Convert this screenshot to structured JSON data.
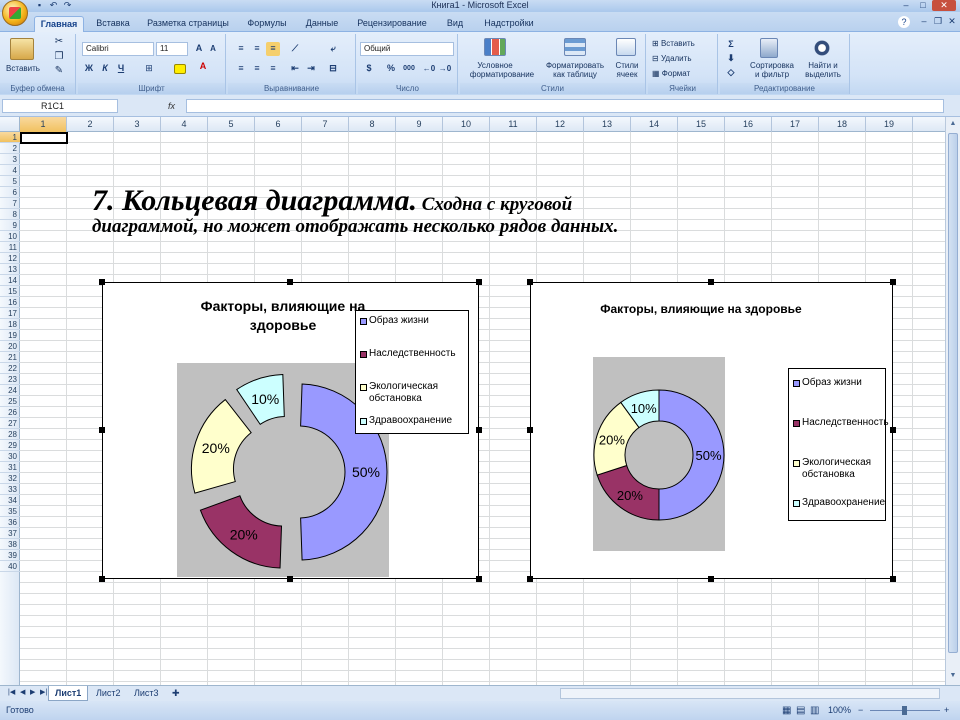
{
  "window": {
    "title": "Книга1 - Microsoft Excel"
  },
  "quick_access": [
    "save-icon",
    "undo-icon",
    "redo-icon"
  ],
  "tabs": [
    "Главная",
    "Вставка",
    "Разметка страницы",
    "Формулы",
    "Данные",
    "Рецензирование",
    "Вид",
    "Надстройки"
  ],
  "ribbon": {
    "clipboard": {
      "label": "Буфер обмена",
      "paste": "Вставить"
    },
    "font": {
      "label": "Шрифт",
      "name": "Calibri",
      "size": "11",
      "bold": "Ж",
      "italic": "К",
      "underline": "Ч"
    },
    "alignment": {
      "label": "Выравнивание"
    },
    "number": {
      "label": "Число",
      "format": "Общий",
      "percent": "%",
      "thousands": "000"
    },
    "styles": {
      "label": "Стили",
      "cond_l1": "Условное",
      "cond_l2": "форматирование",
      "table_l1": "Форматировать",
      "table_l2": "как таблицу",
      "cell_l1": "Стили",
      "cell_l2": "ячеек"
    },
    "cells": {
      "label": "Ячейки",
      "insert": "Вставить",
      "delete": "Удалить",
      "format": "Формат"
    },
    "editing": {
      "label": "Редактирование",
      "sigma": "Σ",
      "sort_l1": "Сортировка",
      "sort_l2": "и фильтр",
      "find_l1": "Найти и",
      "find_l2": "выделить"
    }
  },
  "formula_bar": {
    "name_box": "R1C1",
    "fx": "fx",
    "value": ""
  },
  "columns": [
    "1",
    "2",
    "3",
    "4",
    "5",
    "6",
    "7",
    "8",
    "9",
    "10",
    "11",
    "12",
    "13",
    "14",
    "15",
    "16",
    "17",
    "18",
    "19"
  ],
  "rows": [
    "1",
    "2",
    "3",
    "4",
    "5",
    "6",
    "7",
    "8",
    "9",
    "10",
    "11",
    "12",
    "13",
    "14",
    "15",
    "16",
    "17",
    "18",
    "19",
    "20",
    "21",
    "22",
    "23",
    "24",
    "25",
    "26",
    "27",
    "28",
    "29",
    "30",
    "31",
    "32",
    "33",
    "34",
    "35",
    "36",
    "37",
    "38",
    "39",
    "40"
  ],
  "heading": {
    "big": "7.  Кольцевая диаграмма.",
    "small1": " Сходна с круговой",
    "small2": "диаграммой, но может отображать несколько рядов данных."
  },
  "chart_data": [
    {
      "type": "donut",
      "title_line1": "Факторы, влияющие на",
      "title_line2": "здоровье",
      "exploded": true,
      "categories": [
        "Образ жизни",
        "Наследственность",
        "Экологическая обстановка",
        "Здравоохранение"
      ],
      "legend_lines": [
        [
          "Образ жизни"
        ],
        [
          "Наследственность"
        ],
        [
          "Экологическая",
          "обстановка"
        ],
        [
          "Здравоохранение"
        ]
      ],
      "values": [
        50,
        20,
        20,
        10
      ],
      "labels": [
        "50%",
        "20%",
        "20%",
        "10%"
      ],
      "colors": [
        "#9999ff",
        "#993366",
        "#ffffcc",
        "#ccffff"
      ],
      "plot_bg": "#c0c0c0",
      "legend_position": "top-right"
    },
    {
      "type": "donut",
      "title_line1": "Факторы, влияющие на здоровье",
      "title_line2": "",
      "exploded": false,
      "categories": [
        "Образ жизни",
        "Наследственность",
        "Экологическая обстановка",
        "Здравоохранение"
      ],
      "legend_lines": [
        [
          "Образ жизни"
        ],
        [
          "Наследственность"
        ],
        [
          "Экологическая",
          "обстановка"
        ],
        [
          "Здравоохранение"
        ]
      ],
      "values": [
        50,
        20,
        20,
        10
      ],
      "labels": [
        "50%",
        "20%",
        "20%",
        "10%"
      ],
      "colors": [
        "#9999ff",
        "#993366",
        "#ffffcc",
        "#ccffff"
      ],
      "plot_bg": "#c0c0c0",
      "legend_position": "right"
    }
  ],
  "sheets": [
    "Лист1",
    "Лист2",
    "Лист3"
  ],
  "status": {
    "ready": "Готово",
    "zoom": "100%",
    "minus": "−",
    "plus": "+"
  }
}
